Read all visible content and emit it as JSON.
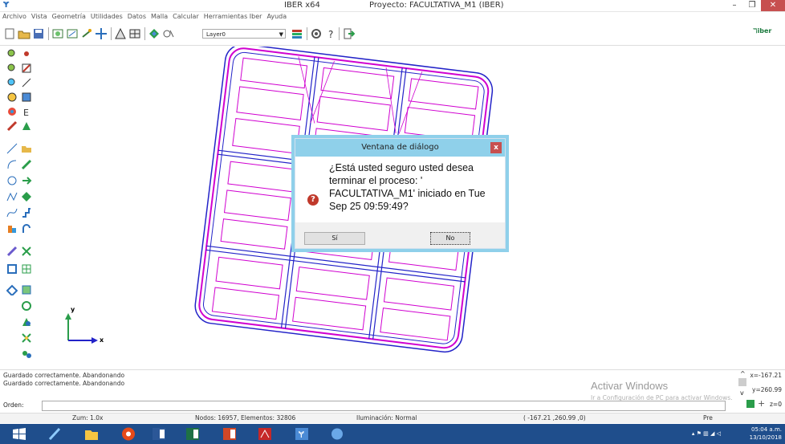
{
  "window": {
    "app_title": "IBER x64",
    "project_title": "Proyecto: FACULTATIVA_M1 (IBER)",
    "controls": [
      "–",
      "❐",
      "✕"
    ]
  },
  "menu": [
    "Archivo",
    "Vista",
    "Geometría",
    "Utilidades",
    "Datos",
    "Malla",
    "Calcular",
    "Herramientas Iber",
    "Ayuda"
  ],
  "toolbar": {
    "layer_value": "Layer0",
    "logo_text": "iber"
  },
  "dialog": {
    "title": "Ventana de diálogo",
    "close_label": "x",
    "icon_glyph": "?",
    "message": "¿Está usted seguro usted desea terminar el proceso: ' FACULTATIVA_M1' iniciado en Tue Sep 25 09:59:49?",
    "yes_label": "Sí",
    "no_label": "No"
  },
  "axes": {
    "y_label": "y",
    "x_label": "x"
  },
  "messages": {
    "line1": "Guardado correctamente. Abandonando",
    "line2": "Guardado correctamente. Abandonando"
  },
  "watermark": {
    "title": "Activar Windows",
    "subtitle": "Ir a Configuración de PC para activar Windows."
  },
  "coords": {
    "x": "x=-167.21",
    "y": "y=260.99",
    "z": "z=0"
  },
  "order": {
    "label": "Orden:"
  },
  "status": {
    "zoom": "Zum: 1.0x",
    "nodes": "Nodos: 16957, Elementos: 32806",
    "lighting": "Iluminación: Normal",
    "coords": "( -167.21 ,260.99 ,0)",
    "mode": "Pre"
  },
  "clock": {
    "time": "05:04 a.m.",
    "date": "13/10/2018"
  },
  "colors": {
    "mesh_magenta": "#d000d0",
    "mesh_blue": "#2323c8",
    "dialog_accent": "#8fd0ea",
    "taskbar": "#1f4e8c"
  }
}
